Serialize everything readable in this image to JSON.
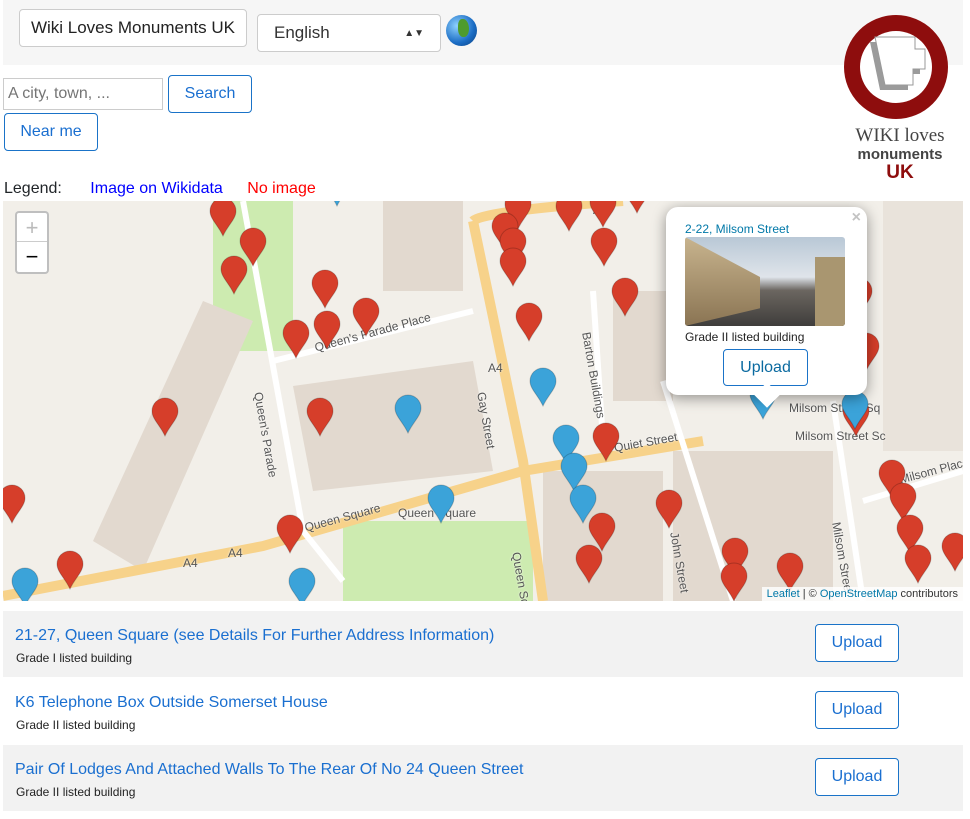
{
  "header": {
    "title_button": "Wiki Loves Monuments UK",
    "language": "English",
    "globe_icon": "globe-icon"
  },
  "search": {
    "placeholder": "A city, town, ...",
    "value": "",
    "search_label": "Search",
    "near_me_label": "Near me"
  },
  "logo": {
    "line1": "WIKI loves",
    "line2": "monuments",
    "line3": "UK"
  },
  "legend": {
    "label": "Legend:",
    "with_image": "Image on Wikidata",
    "no_image": "No image",
    "with_image_color": "#0000ff",
    "no_image_color": "#ff0000"
  },
  "map": {
    "zoom_in": "+",
    "zoom_out": "−",
    "popup": {
      "title": "2-22, Milsom Street",
      "description": "Grade II listed building",
      "upload": "Upload",
      "close": "×"
    },
    "attribution": {
      "leaflet": "Leaflet",
      "sep": " | © ",
      "osm": "OpenStreetMap",
      "suffix": " contributors"
    },
    "streets": [
      "Queen's Parade Place",
      "Queen's Parade",
      "Gay Street",
      "Barton Buildings",
      "Queen Square",
      "Queen Square",
      "Queen Squa",
      "A4",
      "A4",
      "A4",
      "A4",
      "Milsom Street",
      "Milsom Place",
      "Milsom Street",
      "Quiet Street",
      "John Street",
      "Milsom Street Sq",
      "Milsom Street Sc"
    ],
    "marker_colors": {
      "image": "#3ba3d9",
      "no_image": "#d63e2a"
    }
  },
  "results": [
    {
      "title": "21-27, Queen Square (see Details For Further Address Information)",
      "subtitle": "Grade I listed building",
      "upload": "Upload"
    },
    {
      "title": "K6 Telephone Box Outside Somerset House",
      "subtitle": "Grade II listed building",
      "upload": "Upload"
    },
    {
      "title": "Pair Of Lodges And Attached Walls To The Rear Of No 24 Queen Street",
      "subtitle": "Grade II listed building",
      "upload": "Upload"
    }
  ]
}
